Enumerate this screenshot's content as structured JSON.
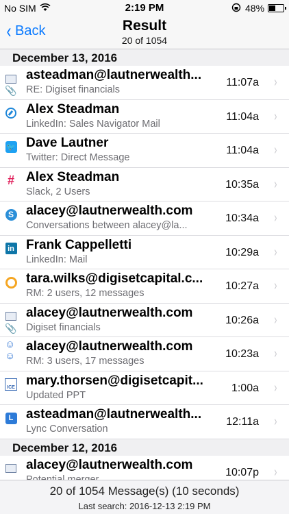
{
  "status": {
    "carrier": "No SIM",
    "time": "2:19 PM",
    "battery": "48%",
    "battery_level": 0.48
  },
  "nav": {
    "back": "Back",
    "title": "Result",
    "subtitle": "20 of 1054"
  },
  "sections": [
    {
      "date": "December 13, 2016",
      "rows": [
        {
          "icon": "mail-icon",
          "title": "asteadman@lautnerwealth...",
          "sub": "RE: Digiset financials",
          "time": "11:07a",
          "attachment": true
        },
        {
          "icon": "safari-icon",
          "title": "Alex Steadman",
          "sub": "LinkedIn: Sales Navigator Mail",
          "time": "11:04a"
        },
        {
          "icon": "twitter-icon",
          "title": "Dave Lautner",
          "sub": "Twitter: Direct Message",
          "time": "11:04a"
        },
        {
          "icon": "slack-icon",
          "title": "Alex Steadman",
          "sub": "Slack, 2 Users",
          "time": "10:35a"
        },
        {
          "icon": "skype-icon",
          "title": "alacey@lautnerwealth.com",
          "sub": "Conversations between alacey@la...",
          "time": "10:34a"
        },
        {
          "icon": "linkedin-icon",
          "title": "Frank Cappelletti",
          "sub": "LinkedIn: Mail",
          "time": "10:29a"
        },
        {
          "icon": "rm-icon",
          "title": "tara.wilks@digisetcapital.c...",
          "sub": "RM: 2 users, 12 messages",
          "time": "10:27a"
        },
        {
          "icon": "mail-icon",
          "title": "alacey@lautnerwealth.com",
          "sub": "Digiset financials",
          "time": "10:26a",
          "attachment": true
        },
        {
          "icon": "people-icon",
          "title": "alacey@lautnerwealth.com",
          "sub": "RM: 3 users, 17 messages",
          "time": "10:23a"
        },
        {
          "icon": "ice-icon",
          "title": "mary.thorsen@digisetcapit...",
          "sub": "Updated PPT",
          "time": "1:00a"
        },
        {
          "icon": "lync-icon",
          "title": "asteadman@lautnerwealth...",
          "sub": "Lync Conversation",
          "time": "12:11a"
        }
      ]
    },
    {
      "date": "December 12, 2016",
      "rows": [
        {
          "icon": "mail-icon",
          "title": "alacey@lautnerwealth.com",
          "sub": "Potential merger",
          "time": "10:07p"
        }
      ]
    }
  ],
  "footer": {
    "count": "20 of 1054 Message(s) (10 seconds)",
    "last_search": "Last search: 2016-12-13 2:19 PM"
  }
}
